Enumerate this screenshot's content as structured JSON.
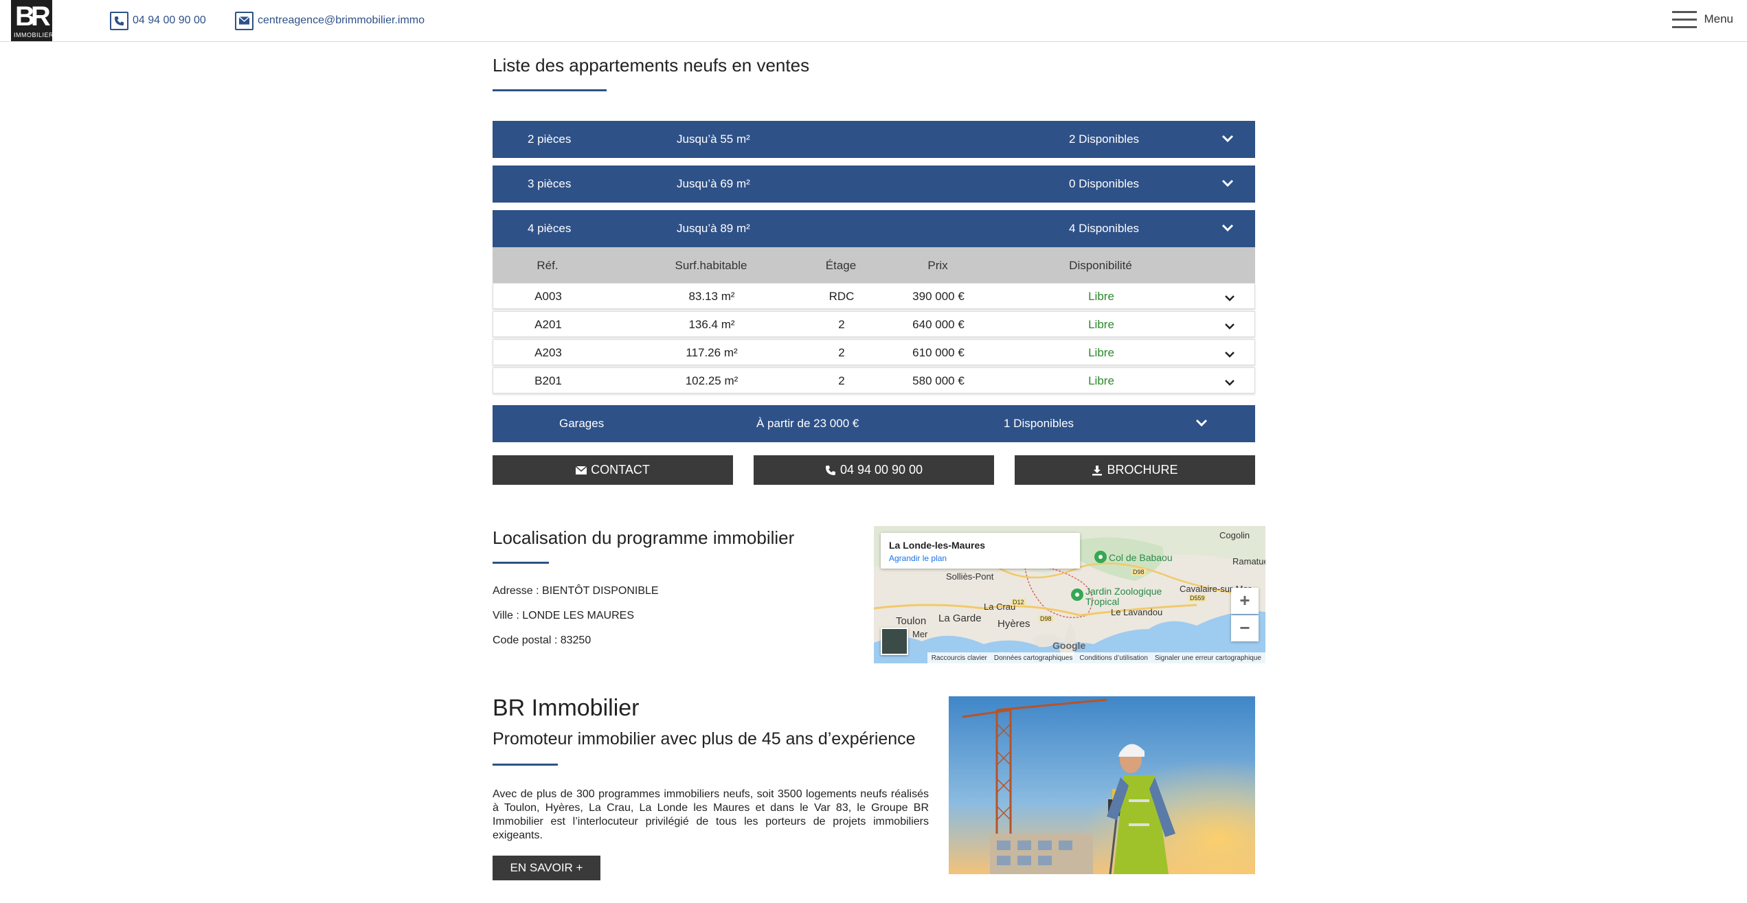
{
  "header": {
    "logo_text": "BR",
    "logo_sub": "IMMOBILIER",
    "phone": "04 94 00 90 00",
    "email": "centreagence@brimmobilier.immo",
    "menu_label": "Menu"
  },
  "listing": {
    "title": "Liste des appartements neufs en ventes",
    "groups": [
      {
        "rooms": "2 pièces",
        "surface": "Jusqu’à 55 m²",
        "available": "2 Disponibles"
      },
      {
        "rooms": "3 pièces",
        "surface": "Jusqu’à 69 m²",
        "available": "0 Disponibles"
      },
      {
        "rooms": "4 pièces",
        "surface": "Jusqu’à 89 m²",
        "available": "4 Disponibles"
      }
    ],
    "table_headers": [
      "Réf.",
      "Surf.habitable",
      "Étage",
      "Prix",
      "Disponibilité"
    ],
    "rows": [
      {
        "ref": "A003",
        "surface": "83.13 m²",
        "floor": "RDC",
        "price": "390 000 €",
        "status": "Libre"
      },
      {
        "ref": "A201",
        "surface": "136.4 m²",
        "floor": "2",
        "price": "640 000 €",
        "status": "Libre"
      },
      {
        "ref": "A203",
        "surface": "117.26 m²",
        "floor": "2",
        "price": "610 000 €",
        "status": "Libre"
      },
      {
        "ref": "B201",
        "surface": "102.25 m²",
        "floor": "2",
        "price": "580 000 €",
        "status": "Libre"
      }
    ],
    "garages": {
      "label": "Garages",
      "price": "À partir de 23 000 €",
      "available": "1 Disponibles"
    }
  },
  "actions": {
    "contact": "CONTACT",
    "phone": "04 94 00 90 00",
    "brochure": "BROCHURE"
  },
  "location": {
    "title": "Localisation du programme immobilier",
    "address": "Adresse : BIENTÔT DISPONIBLE",
    "city": "Ville : LONDE LES MAURES",
    "postal": "Code postal : 83250",
    "map": {
      "popup_title": "La Londe-les-Maures",
      "popup_link": "Agrandir le plan",
      "labels": {
        "sollies": "Solliès-Pont",
        "toulon": "Toulon",
        "lagarde": "La Garde",
        "hyeres": "Hyères",
        "lacrau": "La Crau",
        "lavandou": "Le Lavandou",
        "cavalaire": "Cavalaire-sur-Mer",
        "cogolin": "Cogolin",
        "ramatuelle": "Ramatue",
        "babaou": "Col de Babaou",
        "jardin": "Jardin Zoologique Tropical",
        "mer": "Mer",
        "d98a": "D98",
        "d12": "D12",
        "d98b": "D98",
        "d559": "D559"
      },
      "google": "Google",
      "footer": [
        "Raccourcis clavier",
        "Données cartographiques",
        "Conditions d’utilisation",
        "Signaler une erreur cartographique"
      ]
    }
  },
  "about": {
    "title": "BR Immobilier",
    "subtitle": "Promoteur immobilier avec plus de 45 ans d’expérience",
    "text": "Avec de plus de 300 programmes immobiliers neufs, soit 3500 logements neufs réalisés à Toulon, Hyères, La Crau, La Londe les Maures et dans le Var 83, le Groupe BR Immobilier est l’interlocuteur privilégié de tous les porteurs de projets immobiliers exigeants.",
    "button": "EN SAVOIR +"
  },
  "colors": {
    "brand": "#2e5188",
    "dark_button": "#3a3a3a",
    "available": "#2a8a2a"
  }
}
